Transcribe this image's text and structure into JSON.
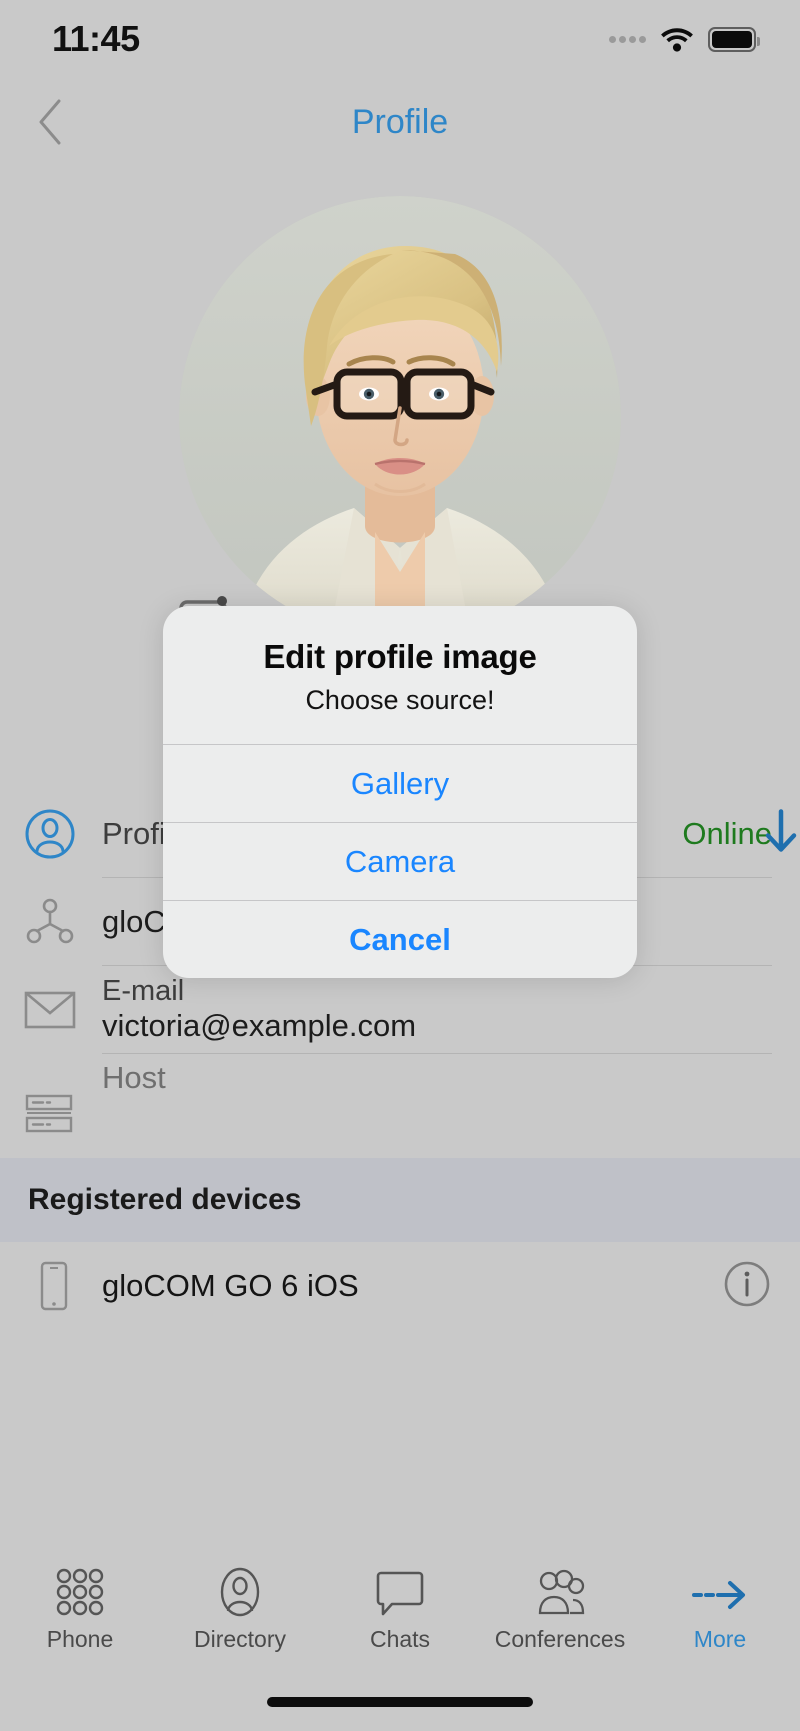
{
  "status_bar": {
    "time": "11:45",
    "signal_icon": "signal-dots-icon",
    "wifi_icon": "wifi-icon",
    "battery_icon": "battery-full-icon"
  },
  "nav": {
    "back_icon": "chevron-left-icon",
    "title": "Profile"
  },
  "avatar": {
    "name": "profile-photo",
    "edit_badge_icon": "camera-icon"
  },
  "profile_fields": [
    {
      "icon": "user-circle-icon",
      "label": "Profile",
      "status_value": "Online",
      "trailing_icon": "arrow-down-icon"
    },
    {
      "icon": "network-share-icon",
      "label": "gloCOM",
      "value": ""
    },
    {
      "icon": "envelope-icon",
      "label": "E-mail",
      "value": "victoria@example.com"
    },
    {
      "icon": "server-rack-icon",
      "label": "Host",
      "value": ""
    }
  ],
  "registered_devices": {
    "header": "Registered devices",
    "items": [
      {
        "device_icon": "mobile-phone-icon",
        "name": "gloCOM GO 6 iOS",
        "info_icon": "info-circle-icon"
      }
    ]
  },
  "tabbar": {
    "items": [
      {
        "label": "Phone",
        "icon": "dialpad-icon",
        "active": false
      },
      {
        "label": "Directory",
        "icon": "contact-icon",
        "active": false
      },
      {
        "label": "Chats",
        "icon": "chat-bubble-icon",
        "active": false
      },
      {
        "label": "Conferences",
        "icon": "people-group-icon",
        "active": false
      },
      {
        "label": "More",
        "icon": "arrow-right-icon",
        "active": true
      }
    ]
  },
  "alert": {
    "title": "Edit profile image",
    "subtitle": "Choose source!",
    "buttons": [
      {
        "label": "Gallery",
        "bold": false
      },
      {
        "label": "Camera",
        "bold": false
      },
      {
        "label": "Cancel",
        "bold": true
      }
    ]
  },
  "colors": {
    "accent_blue": "#2e86c8",
    "alert_blue": "#1a86ff",
    "status_green": "#1e7a1e",
    "page_bg": "#c9c9c9",
    "section_bg": "#bfc1c8"
  }
}
